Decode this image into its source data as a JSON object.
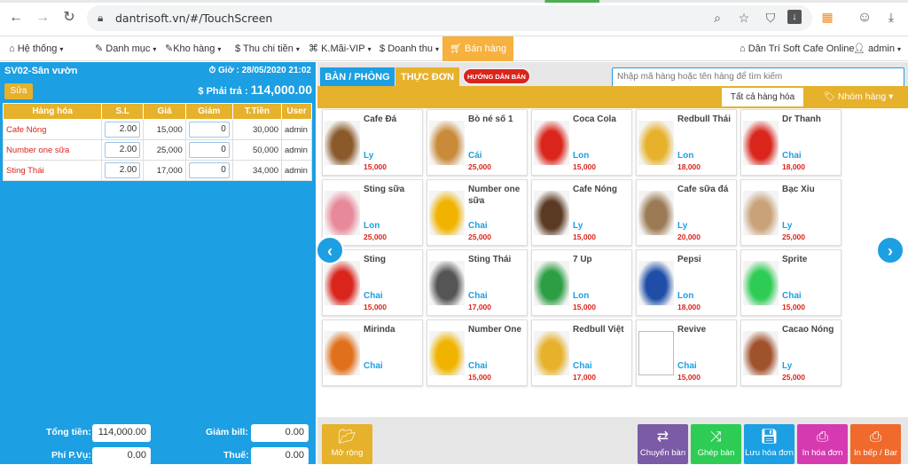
{
  "browser": {
    "url": "dantrisoft.vn/#/TouchScreen"
  },
  "nav": {
    "items": [
      {
        "label": "Hệ thống"
      },
      {
        "label": "Danh mục"
      },
      {
        "label": "Kho hàng"
      },
      {
        "label": "Thu chi tiền"
      },
      {
        "label": "K.Mãi-VIP"
      },
      {
        "label": "Doanh thu"
      }
    ],
    "active": "Bán hàng",
    "company": "Dân Trí Soft Cafe Online",
    "user": "admin"
  },
  "order": {
    "table_name": "SV02-Sân vườn",
    "time_label": "Giờ : 28/05/2020 21:02",
    "edit_label": "Sửa",
    "pay_label": "$ Phải trả :",
    "pay_amount": "114,000.00",
    "columns": [
      "Hàng hóa",
      "S.L",
      "Giá",
      "Giảm",
      "T.Tiền",
      "User"
    ],
    "rows": [
      {
        "name": "Cafe Nóng",
        "qty": "2.00",
        "price": "15,000",
        "discount": "0",
        "total": "30,000",
        "user": "admin"
      },
      {
        "name": "Number one sữa",
        "qty": "2.00",
        "price": "25,000",
        "discount": "0",
        "total": "50,000",
        "user": "admin"
      },
      {
        "name": "Sting Thái",
        "qty": "2.00",
        "price": "17,000",
        "discount": "0",
        "total": "34,000",
        "user": "admin"
      }
    ],
    "summary": {
      "total_label": "Tổng tiền:",
      "total_value": "114,000.00",
      "bill_discount_label": "Giảm bill:",
      "bill_discount_value": "0.00",
      "service_label": "Phí P.Vụ:",
      "service_value": "0.00",
      "tax_label": "Thuế:",
      "tax_value": "0.00"
    }
  },
  "tabs": {
    "tables": "BÀN / PHÒNG",
    "menu": "THỰC ĐƠN",
    "guide": "HƯỚNG DẪN BÁN HÀNG"
  },
  "search": {
    "placeholder": "Nhập mã hàng hoặc tên hàng để tìm kiếm"
  },
  "filter": {
    "all": "Tất cả hàng hóa",
    "group": "Nhóm hàng"
  },
  "products": [
    {
      "name": "Cafe Đá",
      "unit": "Ly",
      "price": "15,000"
    },
    {
      "name": "Bò né số 1",
      "unit": "Cái",
      "price": "25,000"
    },
    {
      "name": "Coca Cola",
      "unit": "Lon",
      "price": "15,000"
    },
    {
      "name": "Redbull Thái",
      "unit": "Lon",
      "price": "18,000"
    },
    {
      "name": "Dr Thanh",
      "unit": "Chai",
      "price": "18,000"
    },
    {
      "name": "Sting sữa",
      "unit": "Lon",
      "price": "25,000"
    },
    {
      "name": "Number one sữa",
      "unit": "Chai",
      "price": "25,000"
    },
    {
      "name": "Cafe Nóng",
      "unit": "Ly",
      "price": "15,000"
    },
    {
      "name": "Cafe sữa đá",
      "unit": "Ly",
      "price": "20,000"
    },
    {
      "name": "Bạc Xỉu",
      "unit": "Ly",
      "price": "25,000"
    },
    {
      "name": "Sting",
      "unit": "Chai",
      "price": "15,000"
    },
    {
      "name": "Sting Thái",
      "unit": "Chai",
      "price": "17,000"
    },
    {
      "name": "7 Up",
      "unit": "Lon",
      "price": "15,000"
    },
    {
      "name": "Pepsi",
      "unit": "Lon",
      "price": "18,000"
    },
    {
      "name": "Sprite",
      "unit": "Chai",
      "price": "15,000"
    },
    {
      "name": "Mirinda",
      "unit": "Chai",
      "price": ""
    },
    {
      "name": "Number One",
      "unit": "Chai",
      "price": "15,000"
    },
    {
      "name": "Redbull Việt",
      "unit": "Chai",
      "price": "17,000"
    },
    {
      "name": "Revive",
      "unit": "Chai",
      "price": "15,000"
    },
    {
      "name": "Cacao Nóng",
      "unit": "Ly",
      "price": "25,000"
    }
  ],
  "actions": {
    "expand": "Mở rộng",
    "move_table": "Chuyển bàn",
    "merge_table": "Ghép bàn",
    "save_order": "Lưu hóa đơn",
    "print_bill": "In hóa đơn",
    "print_kitchen": "In bếp / Bar"
  },
  "colors": {
    "blue": "#1c9fe3",
    "gold": "#e6b12b",
    "red": "#d9251c",
    "purple": "#7b5aa6",
    "green": "#2ecc55",
    "magenta": "#d63ab0",
    "orange": "#ef6a2c"
  }
}
